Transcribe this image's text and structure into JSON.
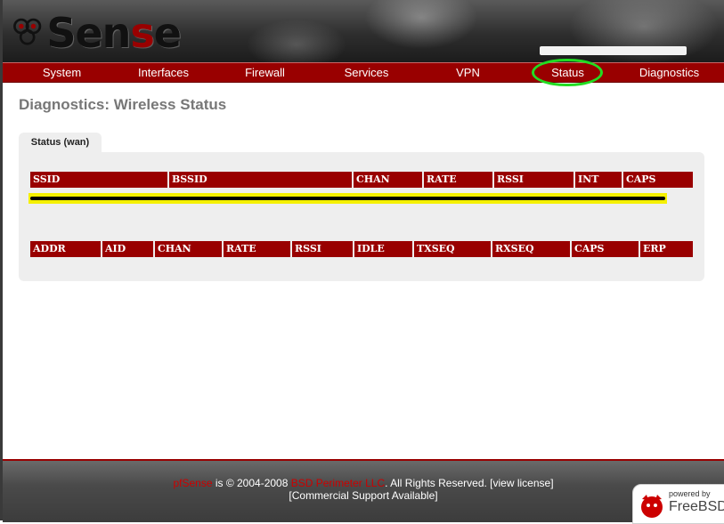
{
  "header": {
    "logo_text_left": "Sen",
    "logo_text_red": "s",
    "logo_text_right": "e"
  },
  "nav": {
    "items": [
      "System",
      "Interfaces",
      "Firewall",
      "Services",
      "VPN",
      "Status",
      "Diagnostics"
    ],
    "highlighted": "Status",
    "highlight_color": "#22dd22"
  },
  "page": {
    "title": "Diagnostics: Wireless Status"
  },
  "tabs": [
    {
      "label": "Status (wan)",
      "active": true
    }
  ],
  "tables": {
    "networks": {
      "columns": [
        "SSID",
        "BSSID",
        "CHAN",
        "RATE",
        "RSSI",
        "INT",
        "CAPS"
      ],
      "rows": []
    },
    "clients": {
      "columns": [
        "ADDR",
        "AID",
        "CHAN",
        "RATE",
        "RSSI",
        "IDLE",
        "TXSEQ",
        "RXSEQ",
        "CAPS",
        "ERP"
      ],
      "rows": []
    }
  },
  "footer": {
    "brand": "pfSense",
    "text_1": " is © 2004-2008 ",
    "company": "BSD Perimeter LLC",
    "text_2": ". All Rights Reserved. [",
    "license_link": "view license",
    "text_3": "]",
    "support_link": "[Commercial Support Available]",
    "badge_small": "powered by",
    "badge_name": "FreeBSD"
  },
  "colors": {
    "accent": "#990000",
    "annotation_highlight": "#f5f000"
  }
}
